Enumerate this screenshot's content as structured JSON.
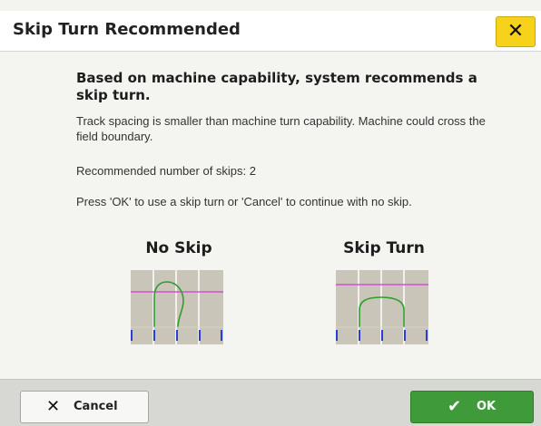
{
  "dialog": {
    "title": "Skip Turn Recommended",
    "close_icon": "close-icon",
    "headline": "Based on machine capability, system recommends a skip turn.",
    "paragraph_1": "Track spacing is smaller than machine turn capability. Machine could cross the field boundary.",
    "paragraph_2": "Recommended number of skips: 2",
    "paragraph_3": "Press 'OK' to use a skip turn or 'Cancel' to continue with no skip.",
    "options": {
      "no_skip_label": "No Skip",
      "skip_turn_label": "Skip Turn"
    }
  },
  "footer": {
    "cancel_label": "Cancel",
    "cancel_icon": "x-icon",
    "ok_label": "OK",
    "ok_icon": "checkmark-icon"
  },
  "colors": {
    "close_button": "#f6d21b",
    "ok_button": "#3f9a3a",
    "boundary_line": "#d44fd4",
    "path_line": "#2e9e2e",
    "track_marks": "#2a3fd6"
  }
}
